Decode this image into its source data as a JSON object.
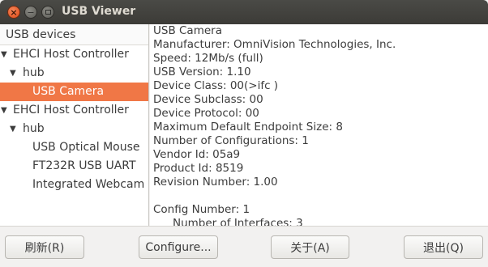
{
  "window": {
    "title": "USB Viewer",
    "close_glyph": "×",
    "minimize_glyph": "−"
  },
  "tree": {
    "header": "USB devices",
    "items": [
      {
        "label": "EHCI Host Controller",
        "expanded": true
      },
      {
        "label": "hub",
        "expanded": true
      },
      {
        "label": "USB Camera",
        "selected": true
      },
      {
        "label": "EHCI Host Controller",
        "expanded": true
      },
      {
        "label": "hub",
        "expanded": true
      },
      {
        "label": "USB Optical Mouse"
      },
      {
        "label": "FT232R USB UART"
      },
      {
        "label": "Integrated Webcam"
      }
    ],
    "expanded_arrow": "▼",
    "selected_color": "#f07746"
  },
  "info": {
    "lines": [
      "USB Camera",
      "Manufacturer: OmniVision Technologies, Inc.",
      "Speed: 12Mb/s (full)",
      "USB Version:  1.10",
      "Device Class: 00(>ifc )",
      "Device Subclass: 00",
      "Device Protocol: 00",
      "Maximum Default Endpoint Size: 8",
      "Number of Configurations: 1",
      "Vendor Id: 05a9",
      "Product Id: 8519",
      "Revision Number:  1.00",
      "",
      "Config Number: 1",
      "Number of Interfaces: 3"
    ]
  },
  "buttons": {
    "refresh": "刷新(R)",
    "configure": "Configure...",
    "about": "关于(A)",
    "quit": "退出(Q)"
  }
}
